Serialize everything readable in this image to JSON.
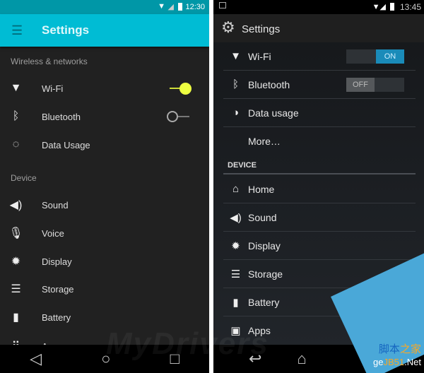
{
  "left": {
    "status": {
      "time": "12:30"
    },
    "toolbar": {
      "title": "Settings"
    },
    "sections": [
      {
        "label": "Wireless & networks",
        "items": [
          {
            "label": "Wi-Fi",
            "icon": "wifi-icon",
            "toggle": "on"
          },
          {
            "label": "Bluetooth",
            "icon": "bluetooth-icon",
            "toggle": "off"
          },
          {
            "label": "Data Usage",
            "icon": "data-usage-icon"
          }
        ]
      },
      {
        "label": "Device",
        "items": [
          {
            "label": "Sound",
            "icon": "sound-icon"
          },
          {
            "label": "Voice",
            "icon": "mic-icon"
          },
          {
            "label": "Display",
            "icon": "display-icon"
          },
          {
            "label": "Storage",
            "icon": "storage-icon"
          },
          {
            "label": "Battery",
            "icon": "battery-icon"
          },
          {
            "label": "Apps",
            "icon": "apps-icon"
          }
        ]
      }
    ],
    "colors": {
      "status": "#0097a7",
      "toolbar": "#00bcd4",
      "toggle_on": "#eeff41"
    }
  },
  "right": {
    "status": {
      "time": "13:45"
    },
    "actionbar": {
      "title": "Settings"
    },
    "items": [
      {
        "label": "Wi-Fi",
        "toggle": "ON"
      },
      {
        "label": "Bluetooth",
        "toggle": "OFF"
      },
      {
        "label": "Data usage"
      },
      {
        "label": "More…"
      }
    ],
    "section": "DEVICE",
    "device_items": [
      {
        "label": "Home"
      },
      {
        "label": "Sound"
      },
      {
        "label": "Display"
      },
      {
        "label": "Storage"
      },
      {
        "label": "Battery"
      },
      {
        "label": "Apps"
      }
    ],
    "colors": {
      "toggle_on": "#1a8bb9"
    }
  },
  "watermark": "MyDrivers",
  "corner_logo": "脚本之家 gejb51.Net"
}
